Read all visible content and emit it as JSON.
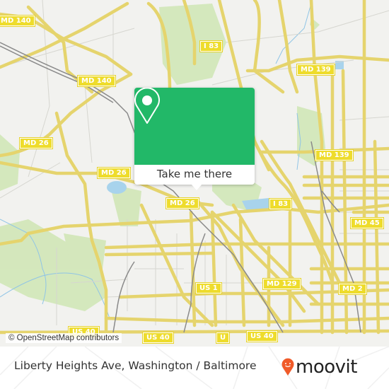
{
  "map": {
    "road_labels": [
      {
        "text": "MD 140",
        "name": "shield-md140-a"
      },
      {
        "text": "I 83",
        "name": "shield-i83-north"
      },
      {
        "text": "MD 139",
        "name": "shield-md139-north"
      },
      {
        "text": "MD 140",
        "name": "shield-md140-b"
      },
      {
        "text": "MD 26",
        "name": "shield-md26-west"
      },
      {
        "text": "MD 139",
        "name": "shield-md139-south"
      },
      {
        "text": "MD 26",
        "name": "shield-md26-mid"
      },
      {
        "text": "MD 26",
        "name": "shield-md26-east"
      },
      {
        "text": "I 83",
        "name": "shield-i83-south"
      },
      {
        "text": "MD 45",
        "name": "shield-md45"
      },
      {
        "text": "US 1",
        "name": "shield-us1"
      },
      {
        "text": "MD 129",
        "name": "shield-md129"
      },
      {
        "text": "MD 2",
        "name": "shield-md2"
      },
      {
        "text": "US 40",
        "name": "shield-us40-a"
      },
      {
        "text": "US 40",
        "name": "shield-us40-b"
      },
      {
        "text": "US 40",
        "name": "shield-us40-c"
      },
      {
        "text": "U",
        "name": "shield-us-partial"
      }
    ],
    "attribution": "© OpenStreetMap contributors"
  },
  "popup": {
    "button_label": "Take me there",
    "accent_color": "#22b868"
  },
  "footer": {
    "location": "Liberty Heights Ave, Washington / Baltimore",
    "brand": "moovit",
    "brand_color": "#f05a28"
  }
}
